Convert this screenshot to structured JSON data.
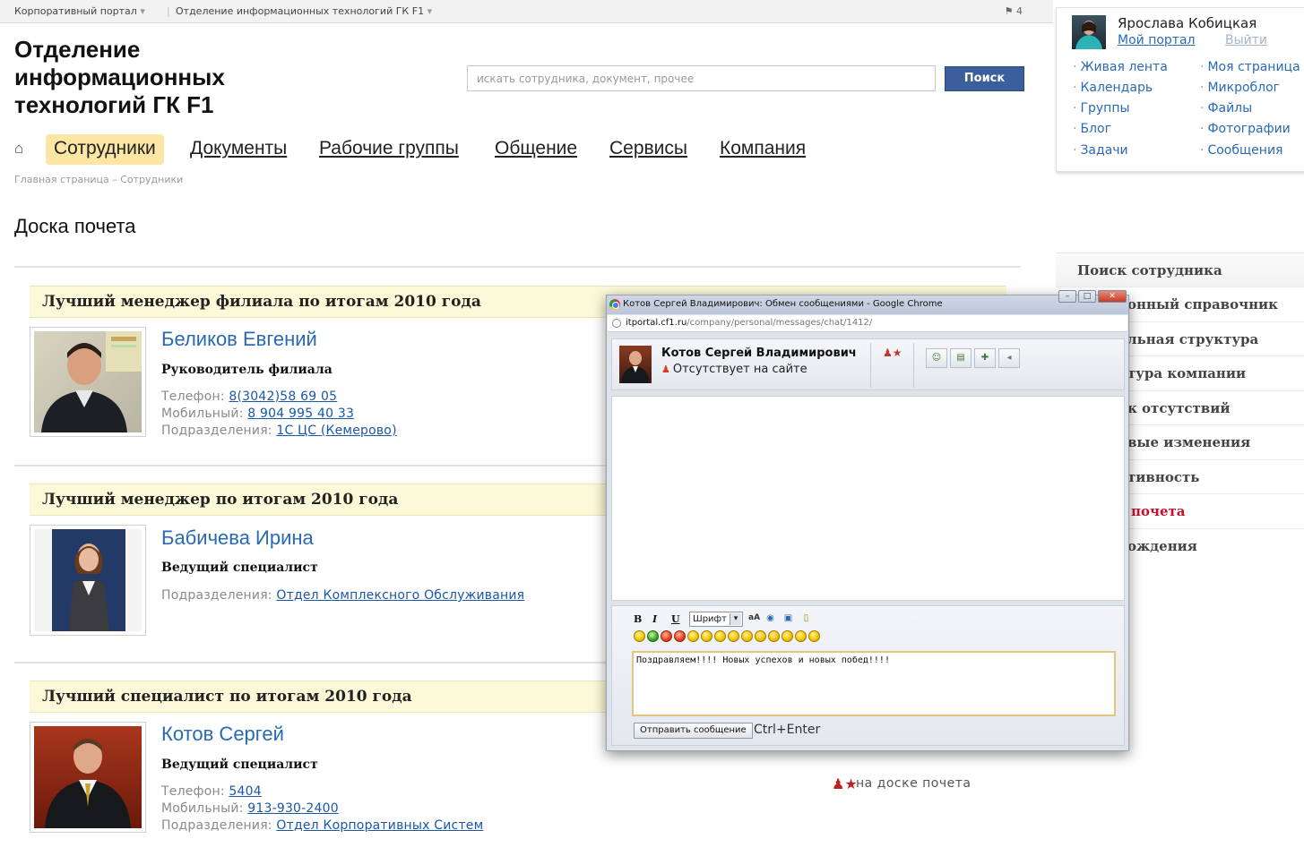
{
  "topbar": {
    "crumbs": [
      "Корпоративный портал",
      "Отделение информационных технологий ГК F1"
    ],
    "counter": "4"
  },
  "portal": {
    "title": "Отделение информационных технологий ГК F1"
  },
  "search": {
    "placeholder": "искать сотрудника, документ, прочее",
    "button": "Поиск"
  },
  "nav": {
    "tabs": [
      "Сотрудники",
      "Документы",
      "Рабочие группы",
      "Общение",
      "Сервисы",
      "Компания"
    ],
    "active": "Сотрудники"
  },
  "page": {
    "breadcrumb": "Главная страница – Сотрудники",
    "heading": "Доска почета"
  },
  "awards": [
    {
      "title": "Лучший менеджер филиала по итогам 2010 года",
      "name": "Беликов Евгений",
      "position": "Руководитель филиала",
      "lines": [
        {
          "label": "Телефон:",
          "value": "8(3042)58 69 05"
        },
        {
          "label": "Мобильный:",
          "value": "8 904 995 40 33"
        },
        {
          "label": "Подразделения:",
          "value": "1С ЦС (Кемерово)"
        }
      ]
    },
    {
      "title": "Лучший менеджер по итогам 2010 года",
      "name": "Бабичева Ирина",
      "position": "Ведущий специалист",
      "lines": [
        {
          "label": "Подразделения:",
          "value": "Отдел Комплексного Обслуживания"
        }
      ]
    },
    {
      "title": "Лучший специалист по итогам 2010 года",
      "name": "Котов Сергей",
      "position": "Ведущий специалист",
      "lines": [
        {
          "label": "Телефон:",
          "value": "5404"
        },
        {
          "label": "Мобильный:",
          "value": "913-930-2400"
        },
        {
          "label": "Подразделения:",
          "value": "Отдел Корпоративных Систем"
        }
      ]
    }
  ],
  "user": {
    "name": "Ярослава Кобицкая",
    "my_portal": "Мой портал",
    "logout": "Выйти",
    "links_left": [
      "Живая лента",
      "Календарь",
      "Группы",
      "Блог",
      "Задачи"
    ],
    "links_right": [
      "Моя страница",
      "Микроблог",
      "Файлы",
      "Фотографии",
      "Сообщения"
    ]
  },
  "sidemenu": {
    "items": [
      "Поиск сотрудника",
      "онный справочник",
      "льная структура",
      "тура компании",
      "к отсутствий",
      "вые изменения",
      "тивность",
      "почета",
      "ождения"
    ],
    "active_index": 7
  },
  "behind": {
    "text": "на доске почета"
  },
  "chat": {
    "window_title": "Котов Сергей Владимирович: Обмен сообщениями - Google Chrome",
    "url_host": "itportal.cf1.ru",
    "url_path": "/company/personal/messages/chat/1412/",
    "contact_name": "Котов Сергей Владимирович",
    "contact_status": "Отсутствует на сайте",
    "toolbar": {
      "bold": "B",
      "italic": "I",
      "underline": "U",
      "font": "Шрифт"
    },
    "message": "Поздравляем!!!! Новых успехов и новых побед!!!!",
    "send_button": "Отправить сообщение",
    "hint": "Ctrl+Enter"
  },
  "colors": {
    "link": "#2a6ab2",
    "award_bg": "#fcf9d8",
    "active_tab": "#fce6a3",
    "search_button": "#3b5f9b",
    "active_menu": "#c8102e"
  }
}
